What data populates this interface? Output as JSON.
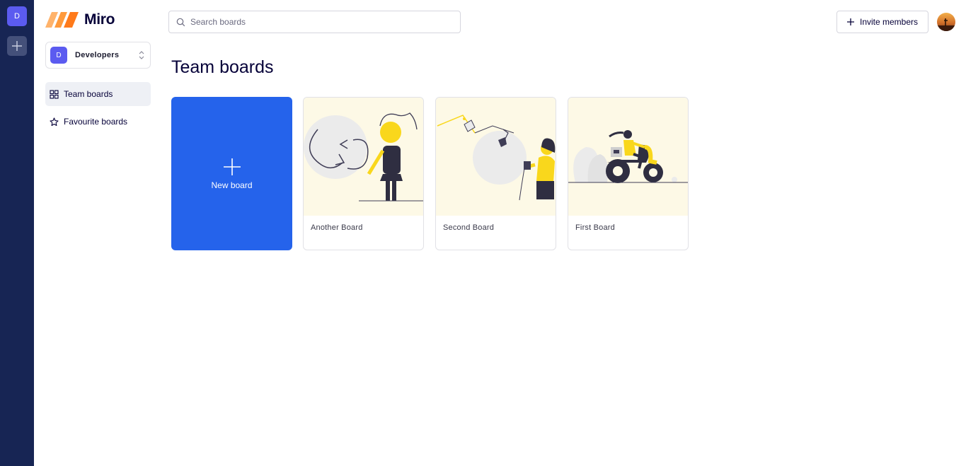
{
  "rail": {
    "team_initial": "D"
  },
  "app": {
    "title": "Miro"
  },
  "team": {
    "initial": "D",
    "name": "Developers"
  },
  "nav": {
    "items": [
      {
        "label": "Team boards",
        "icon": "grid-icon"
      },
      {
        "label": "Favourite boards",
        "icon": "star-icon"
      }
    ]
  },
  "search": {
    "placeholder": "Search boards",
    "value": ""
  },
  "header": {
    "invite_label": "Invite members"
  },
  "page": {
    "title": "Team boards"
  },
  "new_board": {
    "label": "New board"
  },
  "boards": [
    {
      "name": "Another Board"
    },
    {
      "name": "Second Board"
    },
    {
      "name": "First Board"
    }
  ],
  "colors": {
    "rail": "#172554",
    "accent": "#2563eb",
    "team_avatar": "#5b5bf0",
    "thumb_bg": "#fdf9e6",
    "figure_yellow": "#f9d71c"
  }
}
